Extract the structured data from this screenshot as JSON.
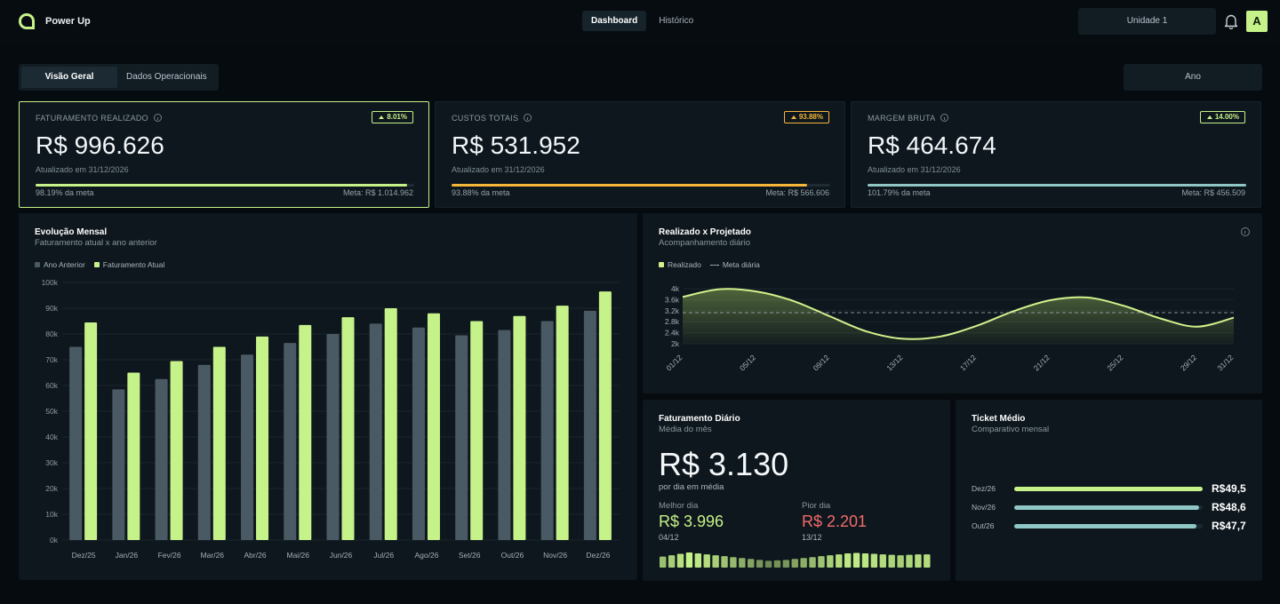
{
  "app": {
    "name": "Power Up",
    "user_initial": "A"
  },
  "nav": [
    {
      "label": "Dashboard",
      "active": true
    },
    {
      "label": "Histórico",
      "active": false
    }
  ],
  "unit_select": "Unidade 1",
  "view_tabs": [
    {
      "label": "Visão Geral",
      "active": true
    },
    {
      "label": "Dados Operacionais",
      "active": false
    }
  ],
  "period": "Ano",
  "kpis": [
    {
      "title": "FATURAMENTO REALIZADO",
      "badge": "8.01%",
      "value": "R$ 996.626",
      "updated": "Atualizado em 31/12/2026",
      "progress_label": "98.19% da meta",
      "progress": 0.9819,
      "meta": "Meta: R$ 1.014.962",
      "color": "#c6f28a"
    },
    {
      "title": "CUSTOS TOTAIS",
      "badge": "93.88%",
      "value": "R$ 531.952",
      "updated": "Atualizado em 31/12/2026",
      "progress_label": "93.88% da meta",
      "progress": 0.9388,
      "meta": "Meta: R$ 566.606",
      "color": "#f5b63a"
    },
    {
      "title": "MARGEM BRUTA",
      "badge": "14.00%",
      "value": "R$ 464.674",
      "updated": "Atualizado em 31/12/2026",
      "progress_label": "101.79% da meta",
      "progress": 1.0,
      "meta": "Meta: R$ 456.509",
      "color": "#8fc6c6"
    }
  ],
  "monthly": {
    "title": "Evolução Mensal",
    "subtitle": "Faturamento atual x ano anterior"
  },
  "projected": {
    "title": "Realizado x Projetado",
    "subtitle": "Acompanhamento diário"
  },
  "daily": {
    "title": "Faturamento Diário",
    "subtitle": "Média do mês",
    "value": "R$ 3.130",
    "value_sub": "por dia em média",
    "best_label": "Melhor dia",
    "best_value": "R$ 3.996",
    "best_date": "04/12",
    "worst_label": "Pior dia",
    "worst_value": "R$ 2.201",
    "worst_date": "13/12",
    "spark": [
      3.1,
      3.4,
      3.7,
      3.996,
      3.8,
      3.6,
      3.4,
      3.2,
      3.0,
      2.8,
      2.6,
      2.4,
      2.201,
      2.3,
      2.4,
      2.6,
      2.8,
      3.0,
      3.2,
      3.4,
      3.6,
      3.8,
      3.9,
      3.8,
      3.7,
      3.6,
      3.5,
      3.4,
      3.5,
      3.6,
      3.6
    ]
  },
  "ticket": {
    "title": "Ticket Médio",
    "subtitle": "Comparativo mensal",
    "rows": [
      {
        "label": "Dez/26",
        "value": "R$49,5",
        "fraction": 1.0,
        "color": "#c6f28a"
      },
      {
        "label": "Nov/26",
        "value": "R$48,6",
        "fraction": 0.98,
        "color": "#8fc6c6"
      },
      {
        "label": "Out/26",
        "value": "R$47,7",
        "fraction": 0.965,
        "color": "#8fc6c6"
      }
    ]
  },
  "chart_data": [
    {
      "type": "bar",
      "categories": [
        "Dez/25",
        "Jan/26",
        "Fev/26",
        "Mar/26",
        "Abr/26",
        "Mai/26",
        "Jun/26",
        "Jul/26",
        "Ago/26",
        "Set/26",
        "Out/26",
        "Nov/26",
        "Dez/26"
      ],
      "series": [
        {
          "name": "Ano Anterior",
          "values": [
            75000,
            58500,
            62500,
            68000,
            72000,
            76500,
            80000,
            84000,
            82500,
            79500,
            81500,
            85000,
            89000
          ],
          "color": "#4a5a64"
        },
        {
          "name": "Faturamento Atual",
          "values": [
            84500,
            65000,
            69500,
            75000,
            79000,
            83500,
            86500,
            90000,
            88000,
            85000,
            87000,
            91000,
            96500
          ],
          "color": "#c6f28a"
        }
      ],
      "yticks": [
        "0k",
        "10k",
        "20k",
        "30k",
        "40k",
        "50k",
        "60k",
        "70k",
        "80k",
        "90k",
        "100k"
      ],
      "ylim": [
        0,
        100000
      ],
      "grid": true,
      "legend": "top-left"
    },
    {
      "type": "area",
      "x_labels": [
        "01/12",
        "05/12",
        "09/12",
        "13/12",
        "17/12",
        "21/12",
        "25/12",
        "29/12",
        "31/12"
      ],
      "series": [
        {
          "name": "Realizado",
          "x": [
            1,
            3,
            5,
            7,
            9,
            11,
            13,
            15,
            17,
            19,
            21,
            23,
            25,
            27,
            29,
            31
          ],
          "values": [
            3700,
            3980,
            3900,
            3560,
            3000,
            2450,
            2180,
            2260,
            2650,
            3180,
            3580,
            3680,
            3380,
            2920,
            2620,
            2950
          ],
          "color": "#d2f28c"
        },
        {
          "name": "Meta diária",
          "x": [
            1,
            31
          ],
          "values": [
            3130,
            3130
          ],
          "color": "#a9b4bb"
        }
      ],
      "yticks": [
        "2k",
        "2.4k",
        "2.8k",
        "3.2k",
        "3.6k",
        "4k"
      ],
      "ylim": [
        2000,
        4000
      ],
      "legend": "top-left"
    }
  ]
}
